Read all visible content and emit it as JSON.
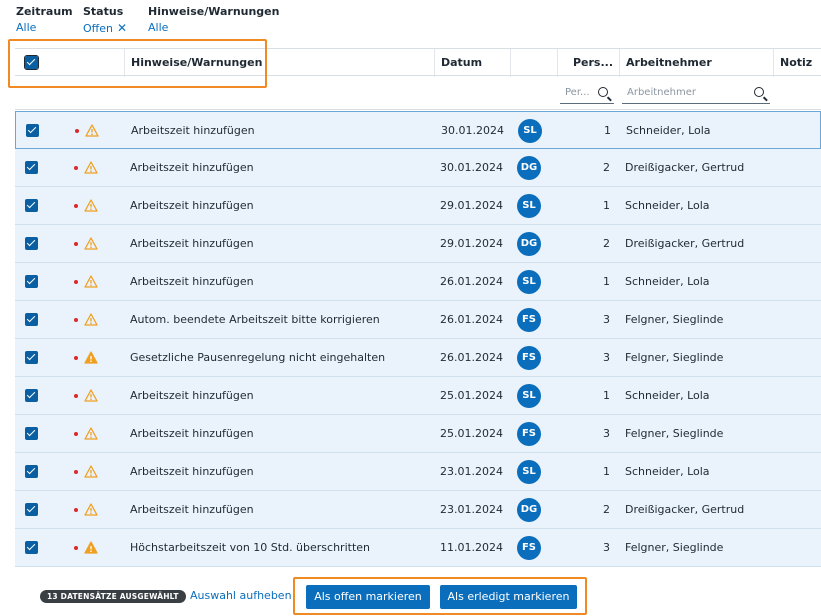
{
  "filters": [
    {
      "label": "Zeitraum",
      "value": "Alle"
    },
    {
      "label": "Status",
      "value": "Offen"
    },
    {
      "label": "Hinweise/Warnungen",
      "value": "Alle"
    }
  ],
  "columns": {
    "hinweise": "Hinweise/Warnungen",
    "datum": "Datum",
    "pers": "Pers...",
    "arbeitnehmer": "Arbeitnehmer",
    "notiz": "Notiz"
  },
  "column_filters": {
    "pers_placeholder": "Per...",
    "arbeitnehmer_placeholder": "Arbeitnehmer"
  },
  "colors": {
    "accent": "#0a6ebd",
    "row_selected": "#eaf3fb",
    "warning": "#f0a020",
    "error_dot": "#d92b2b",
    "highlight": "#f08a24"
  },
  "rows": [
    {
      "warning_style": "outline",
      "text": "Arbeitszeit hinzufügen",
      "date": "30.01.2024",
      "initials": "SL",
      "pers": "1",
      "name": "Schneider, Lola"
    },
    {
      "warning_style": "outline",
      "text": "Arbeitszeit hinzufügen",
      "date": "30.01.2024",
      "initials": "DG",
      "pers": "2",
      "name": "Dreißigacker, Gertrud"
    },
    {
      "warning_style": "outline",
      "text": "Arbeitszeit hinzufügen",
      "date": "29.01.2024",
      "initials": "SL",
      "pers": "1",
      "name": "Schneider, Lola"
    },
    {
      "warning_style": "outline",
      "text": "Arbeitszeit hinzufügen",
      "date": "29.01.2024",
      "initials": "DG",
      "pers": "2",
      "name": "Dreißigacker, Gertrud"
    },
    {
      "warning_style": "outline",
      "text": "Arbeitszeit hinzufügen",
      "date": "26.01.2024",
      "initials": "SL",
      "pers": "1",
      "name": "Schneider, Lola"
    },
    {
      "warning_style": "outline",
      "text": "Autom. beendete Arbeitszeit bitte korrigieren",
      "date": "26.01.2024",
      "initials": "FS",
      "pers": "3",
      "name": "Felgner, Sieglinde"
    },
    {
      "warning_style": "filled",
      "text": "Gesetzliche Pausenregelung nicht eingehalten",
      "date": "26.01.2024",
      "initials": "FS",
      "pers": "3",
      "name": "Felgner, Sieglinde"
    },
    {
      "warning_style": "outline",
      "text": "Arbeitszeit hinzufügen",
      "date": "25.01.2024",
      "initials": "SL",
      "pers": "1",
      "name": "Schneider, Lola"
    },
    {
      "warning_style": "outline",
      "text": "Arbeitszeit hinzufügen",
      "date": "25.01.2024",
      "initials": "FS",
      "pers": "3",
      "name": "Felgner, Sieglinde"
    },
    {
      "warning_style": "outline",
      "text": "Arbeitszeit hinzufügen",
      "date": "23.01.2024",
      "initials": "SL",
      "pers": "1",
      "name": "Schneider, Lola"
    },
    {
      "warning_style": "outline",
      "text": "Arbeitszeit hinzufügen",
      "date": "23.01.2024",
      "initials": "DG",
      "pers": "2",
      "name": "Dreißigacker, Gertrud"
    },
    {
      "warning_style": "filled",
      "text": "Höchstarbeitszeit von 10 Std. überschritten",
      "date": "11.01.2024",
      "initials": "FS",
      "pers": "3",
      "name": "Felgner, Sieglinde"
    }
  ],
  "footer": {
    "count_badge": "13 DATENSÄTZE AUSGEWÄHLT",
    "clear_selection": "Auswahl aufheben",
    "mark_open": "Als offen markieren",
    "mark_done": "Als erledigt markieren"
  }
}
